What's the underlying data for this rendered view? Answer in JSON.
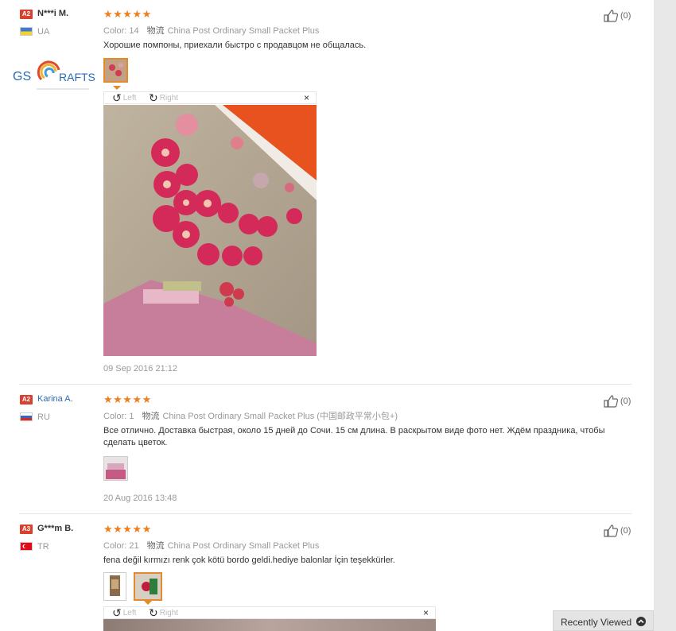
{
  "reviews": [
    {
      "level": "A2",
      "name": "N***i M.",
      "country": "UA",
      "stars": "★★★★★",
      "color_label": "Color:",
      "color_value": "14",
      "shipping_key": "物流",
      "shipping_value": "China Post Ordinary Small Packet Plus",
      "text": "Хорошие помпоны, приехали быстро с продавцом не общалась.",
      "date": "09 Sep 2016 21:12",
      "helpful": "(0)"
    },
    {
      "level": "A2",
      "name": "Karina A.",
      "country": "RU",
      "stars": "★★★★★",
      "color_label": "Color:",
      "color_value": "1",
      "shipping_key": "物流",
      "shipping_value": "China Post Ordinary Small Packet Plus (中国邮政平常小包+)",
      "text": "Все отлично. Доставка быстрая, около 15 дней до Сочи. 15 см длина. В раскрытом виде фото нет. Ждём праздника, чтобы сделать цветок.",
      "date": "20 Aug 2016 13:48",
      "helpful": "(0)"
    },
    {
      "level": "A3",
      "name": "G***m B.",
      "country": "TR",
      "stars": "★★★★★",
      "color_label": "Color:",
      "color_value": "21",
      "shipping_key": "物流",
      "shipping_value": "China Post Ordinary Small Packet Plus",
      "text": "fena değil kırmızı renk çok kötü bordo geldi.hediye balonlar İçin teşekkürler.",
      "helpful": "(0)"
    }
  ],
  "viewer": {
    "left": "Left",
    "right": "Right",
    "close": "×"
  },
  "logo": {
    "text_a": "GS",
    "text_b": "RAFTS"
  },
  "recently_viewed": "Recently Viewed",
  "colors": {
    "accent": "#f07e1c",
    "badge": "#d8412e",
    "link": "#2a6ab4"
  }
}
